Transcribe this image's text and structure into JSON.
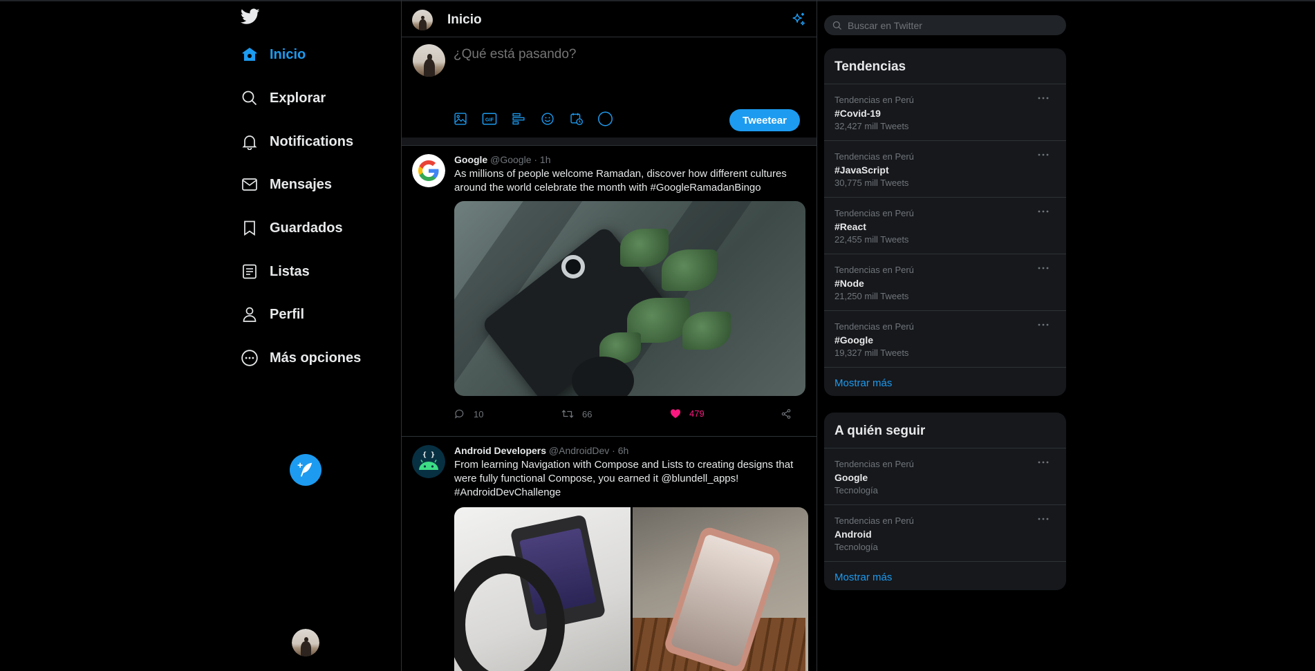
{
  "nav": {
    "items": [
      {
        "label": "Inicio",
        "icon": "home-icon",
        "active": true
      },
      {
        "label": "Explorar",
        "icon": "search-icon"
      },
      {
        "label": "Notifications",
        "icon": "bell-icon"
      },
      {
        "label": "Mensajes",
        "icon": "mail-icon"
      },
      {
        "label": "Guardados",
        "icon": "bookmark-icon"
      },
      {
        "label": "Listas",
        "icon": "list-icon"
      },
      {
        "label": "Perfil",
        "icon": "user-icon"
      },
      {
        "label": "Más opciones",
        "icon": "more-circle-icon"
      }
    ]
  },
  "header": {
    "title": "Inicio"
  },
  "composer": {
    "placeholder": "¿Qué está pasando?",
    "tweet_button": "Tweetear"
  },
  "tweets": [
    {
      "name": "Google",
      "handle": "@Google · 1h",
      "text": "As millions of people welcome Ramadan, discover how different cultures around the world celebrate the month with #GoogleRamadanBingo",
      "replies": "10",
      "retweets": "66",
      "likes": "479",
      "liked": true
    },
    {
      "name": "Android Developers",
      "handle": "@AndroidDev · 6h",
      "text": "From learning Navigation with Compose and Lists to creating designs that were fully functional Compose, you earned it @blundell_apps! #AndroidDevChallenge"
    }
  ],
  "search": {
    "placeholder": "Buscar en Twitter"
  },
  "trends": {
    "title": "Tendencias",
    "items": [
      {
        "context": "Tendencias en Perú",
        "tag": "#Covid-19",
        "count": "32,427 mill Tweets"
      },
      {
        "context": "Tendencias en Perú",
        "tag": "#JavaScript",
        "count": "30,775 mill Tweets"
      },
      {
        "context": "Tendencias en Perú",
        "tag": "#React",
        "count": "22,455 mill Tweets"
      },
      {
        "context": "Tendencias en Perú",
        "tag": "#Node",
        "count": "21,250 mill Tweets"
      },
      {
        "context": "Tendencias en Perú",
        "tag": "#Google",
        "count": "19,327 mill Tweets"
      }
    ],
    "show_more": "Mostrar más"
  },
  "follow": {
    "title": "A quién seguir",
    "items": [
      {
        "context": "Tendencias en Perú",
        "name": "Google",
        "category": "Tecnología"
      },
      {
        "context": "Tendencias en Perú",
        "name": "Android",
        "category": "Tecnología"
      }
    ],
    "show_more": "Mostrar más"
  },
  "colors": {
    "accent": "#1d9bf0",
    "like": "#f91880",
    "background": "#000000",
    "panel": "#16181c"
  }
}
